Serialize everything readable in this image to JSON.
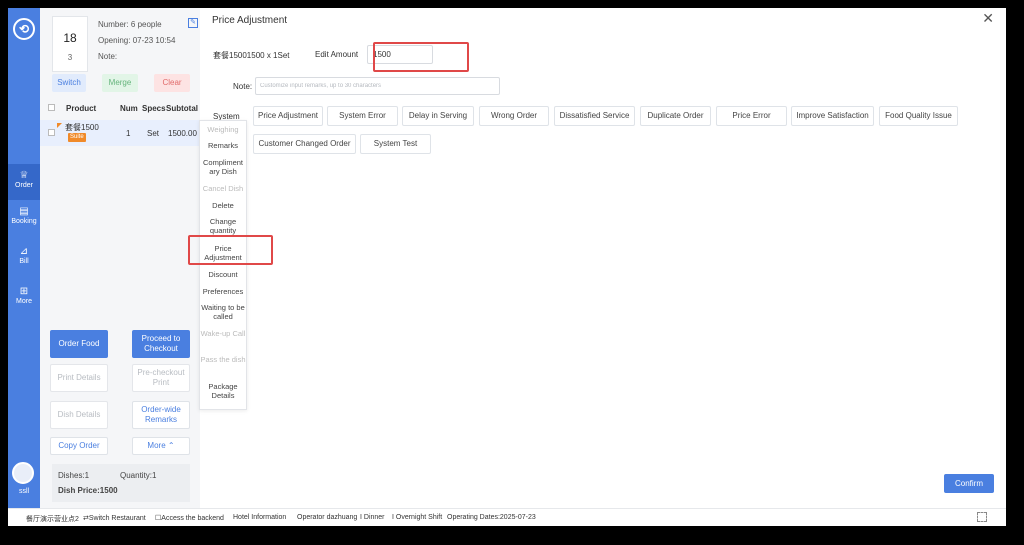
{
  "rail": {
    "items": [
      {
        "icon": "order-icon",
        "label": "Order"
      },
      {
        "icon": "booking-icon",
        "label": "Booking"
      },
      {
        "icon": "bill-icon",
        "label": "Bill"
      },
      {
        "icon": "more-icon",
        "label": "More"
      }
    ],
    "user": "ssll"
  },
  "table": {
    "number": "18",
    "guest_count": "3",
    "number_line": "Number: 6 people",
    "opening_line": "Opening: 07-23 10:54",
    "note_line": "Note:"
  },
  "table_actions": {
    "switch": "Switch",
    "merge": "Merge",
    "clear": "Clear"
  },
  "order_table": {
    "headers": {
      "product": "Product",
      "num": "Num",
      "specs": "Specs",
      "subtotal": "Subtotal"
    },
    "row": {
      "product": "套餐1500",
      "badge": "Suite",
      "num": "1",
      "specs": "Set",
      "subtotal": "1500.00"
    }
  },
  "context_menu": [
    {
      "label": "Weighing",
      "enabled": false
    },
    {
      "label": "Remarks",
      "enabled": true
    },
    {
      "label": "Compliment ary Dish",
      "enabled": true
    },
    {
      "label": "Cancel Dish",
      "enabled": false
    },
    {
      "label": "Delete",
      "enabled": true
    },
    {
      "label": "Change quantity",
      "enabled": true
    },
    {
      "label": "Price Adjustment",
      "enabled": true
    },
    {
      "label": "Discount",
      "enabled": true
    },
    {
      "label": "Preferences",
      "enabled": true
    },
    {
      "label": "Waiting to be called",
      "enabled": true
    },
    {
      "label": "Wake-up Call",
      "enabled": false
    },
    {
      "label": "Pass the dish",
      "enabled": false
    },
    {
      "label": "Package Details",
      "enabled": true
    }
  ],
  "buttons": {
    "order_food": "Order Food",
    "proceed_checkout": "Proceed to Checkout",
    "print_details": "Print Details",
    "pre_checkout_print": "Pre-checkout Print",
    "dish_details": "Dish Details",
    "order_wide_remarks": "Order-wide Remarks",
    "copy_order": "Copy Order",
    "more": "More ⌃"
  },
  "summary": {
    "dishes": "Dishes:1",
    "quantity": "Quantity:1",
    "dish_price": "Dish Price:1500"
  },
  "dialog": {
    "title": "Price Adjustment",
    "dish_line": "套餐15001500 x 1Set",
    "edit_amount_label": "Edit Amount",
    "edit_amount_value": "1500",
    "note_label": "Note:",
    "note_placeholder": "Customize input remarks, up to 30 characters",
    "system_label": "System",
    "reasons": [
      "Price Adjustment",
      "System Error",
      "Delay in Serving",
      "Wrong Order",
      "Dissatisfied Service",
      "Duplicate Order",
      "Price Error",
      "Improve Satisfaction",
      "Food Quality Issue",
      "Customer Changed Order",
      "System Test"
    ],
    "confirm": "Confirm"
  },
  "status_bar": [
    "餐厅演示营业点2",
    "⇄Switch Restaurant",
    "☐Access the backend",
    "Hotel Information",
    "Operator dazhuang",
    "I Dinner",
    "I Overnight Shift",
    "Operating Dates:2025-07-23"
  ],
  "colors": {
    "primary": "#4a7fe0",
    "highlight": "#e04848",
    "badge": "#f08a2a"
  }
}
